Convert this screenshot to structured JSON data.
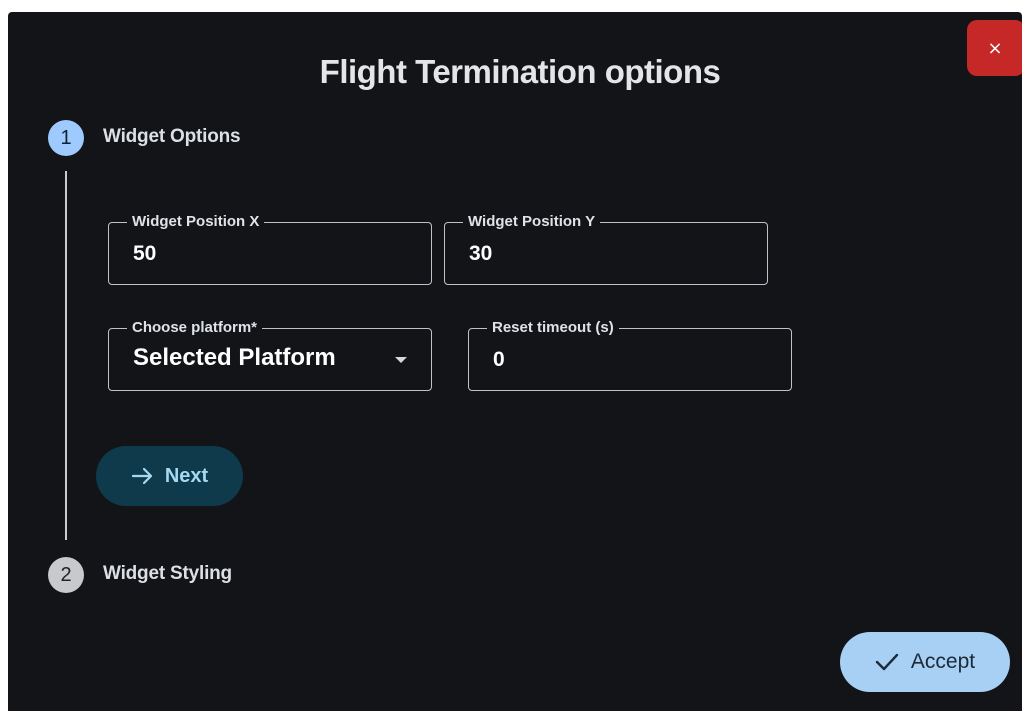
{
  "dialog": {
    "title": "Flight Termination options",
    "close_label": "×"
  },
  "stepper": {
    "steps": [
      {
        "number": "1",
        "label": "Widget Options",
        "state": "active"
      },
      {
        "number": "2",
        "label": "Widget Styling",
        "state": "inactive"
      }
    ]
  },
  "form": {
    "position_x": {
      "label": "Widget Position X",
      "value": "50"
    },
    "position_y": {
      "label": "Widget Position Y",
      "value": "30"
    },
    "platform": {
      "label": "Choose platform*",
      "value": "Selected Platform"
    },
    "reset_timeout": {
      "label": "Reset timeout (s)",
      "value": "0"
    }
  },
  "buttons": {
    "next_label": "Next",
    "accept_label": "Accept"
  },
  "icons": {
    "close": "close-icon",
    "next": "arrow-right-icon",
    "accept": "check-icon",
    "dropdown": "chevron-down-icon"
  },
  "colors": {
    "background": "#121418",
    "close_button": "#c62828",
    "step_active": "#9ecaff",
    "step_inactive": "#c8c9cc",
    "next_button": "#0e3a4c",
    "accept_button": "#a8d0f5"
  }
}
